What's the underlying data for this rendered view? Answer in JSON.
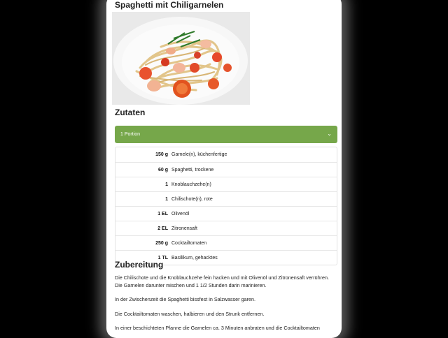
{
  "recipe": {
    "title": "Spaghetti mit Chiligarnelen"
  },
  "ingredients_section": {
    "heading": "Zutaten",
    "portion_select": "1 Portion",
    "items": [
      {
        "amount": "150 g",
        "name": "Garnele(n), küchenfertige"
      },
      {
        "amount": "60 g",
        "name": "Spaghetti, trockene"
      },
      {
        "amount": "1",
        "name": "Knoblauchzehe(n)"
      },
      {
        "amount": "1",
        "name": "Chilischote(n), rote"
      },
      {
        "amount": "1 EL",
        "name": "Olivenöl"
      },
      {
        "amount": "2 EL",
        "name": "Zitronensaft"
      },
      {
        "amount": "250 g",
        "name": "Cocktailtomaten"
      },
      {
        "amount": "1 TL",
        "name": "Basilikum, gehacktes"
      }
    ]
  },
  "preparation": {
    "heading": "Zubereitung",
    "paragraphs": [
      "Die Chilischote und die Knoblauchzehe fein hacken und mit Olivenöl und Zitronensaft verrühren. Die Garnelen darunter mischen und 1 1/2 Stunden darin marinieren.",
      "In der Zwischenzeit die Spaghetti bissfest in Salzwasser garen.",
      "Die Cocktailtomaten waschen, halbieren und den Strunk entfernen.",
      "In einer beschichteten Pfanne die Garnelen ca. 3 Minuten anbraten und die Cocktailtomaten"
    ]
  },
  "icons": {
    "select_chevron": "chevron-down-icon"
  },
  "colors": {
    "accent_green": "#76a74a"
  }
}
